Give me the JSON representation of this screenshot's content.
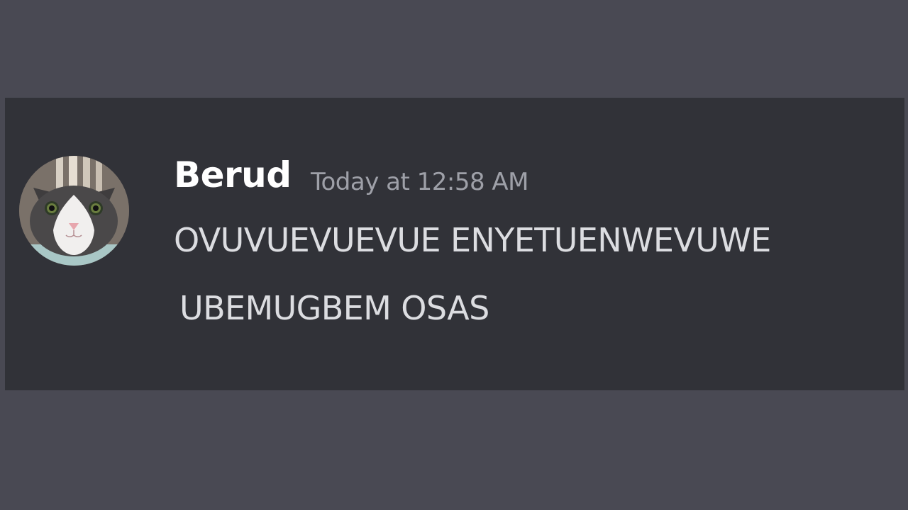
{
  "message": {
    "author": "Berud",
    "timestamp": "Today at 12:58 AM",
    "lines": [
      "OVUVUEVUEVUE ENYETUENWEVUWE",
      "UBEMUGBEM OSAS"
    ],
    "avatar_icon": "cat-avatar-icon"
  },
  "colors": {
    "page_background": "#494953",
    "message_background": "#313238",
    "author": "#ffffff",
    "timestamp": "#9ea0a8",
    "message_text": "#dcdde1"
  }
}
